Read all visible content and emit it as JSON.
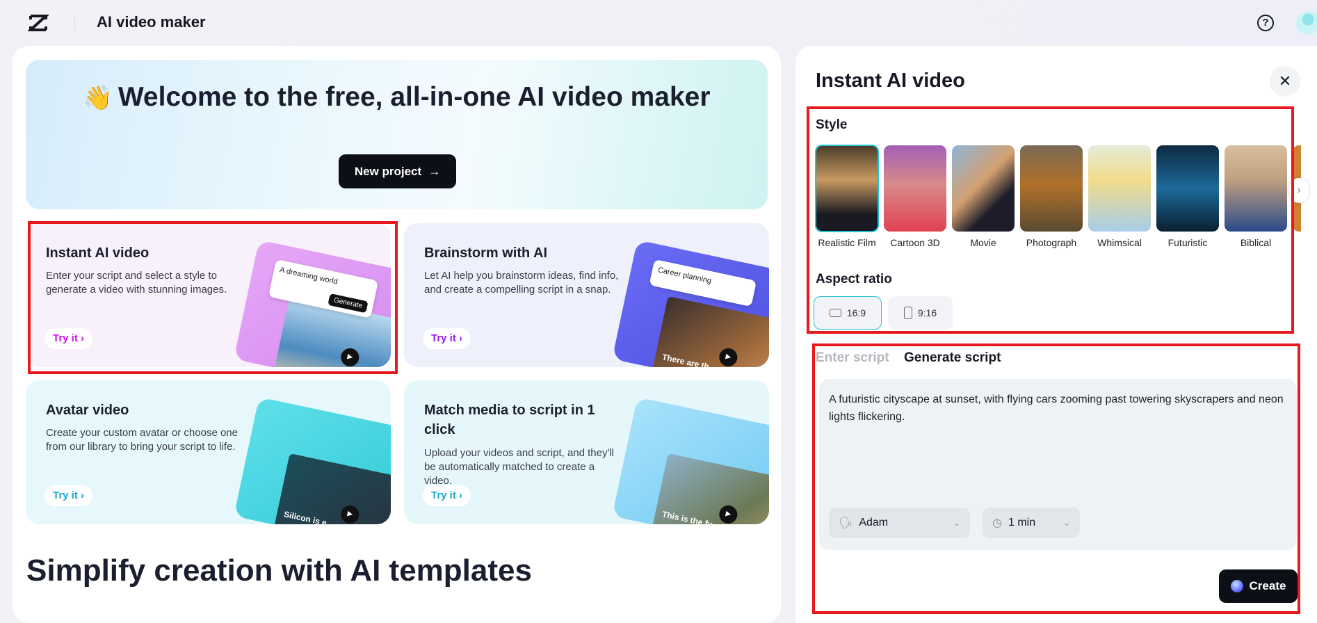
{
  "header": {
    "title": "AI video maker",
    "logo": "capcut-logo",
    "help_icon": "help-circle-icon"
  },
  "hero": {
    "emoji": "👋",
    "title": "Welcome to the free, all-in-one AI video maker",
    "button": "New project",
    "button_icon": "→"
  },
  "cards": [
    {
      "title": "Instant AI video",
      "desc": "Enter your script and select a style to generate a video with stunning images.",
      "cta": "Try it",
      "accent": "#d60ff4",
      "illus_popup": "A dreaming world",
      "illus_button": "Generate"
    },
    {
      "title": "Brainstorm with AI",
      "desc": "Let AI help you brainstorm ideas, find info, and create a compelling script in a snap.",
      "cta": "Try it",
      "accent": "#9b14f5",
      "illus_popup": "Career planning",
      "illus_caption": "There are th"
    },
    {
      "title": "Avatar video",
      "desc": "Create your custom avatar or choose one from our library to bring your script to life.",
      "cta": "Try it",
      "accent": "#16a8d8",
      "illus_caption": "Silicon is e"
    },
    {
      "title": "Match media to script in 1 click",
      "desc": "Upload your videos and script, and they'll be automatically matched to create a video.",
      "cta": "Try it",
      "accent": "#16a8d8",
      "illus_caption": "This is the fu"
    }
  ],
  "templates_heading": "Simplify creation with AI templates",
  "panel": {
    "title": "Instant AI video",
    "style_label": "Style",
    "styles": [
      {
        "label": "Realistic Film",
        "selected": true
      },
      {
        "label": "Cartoon 3D"
      },
      {
        "label": "Movie"
      },
      {
        "label": "Photograph"
      },
      {
        "label": "Whimsical"
      },
      {
        "label": "Futuristic"
      },
      {
        "label": "Biblical"
      }
    ],
    "aspect_label": "Aspect ratio",
    "aspects": [
      {
        "label": "16:9",
        "selected": true
      },
      {
        "label": "9:16"
      }
    ],
    "tabs": [
      {
        "label": "Enter script",
        "active": false
      },
      {
        "label": "Generate script",
        "active": true
      }
    ],
    "script": "A futuristic cityscape at sunset, with flying cars zooming past towering skyscrapers and neon lights flickering.",
    "voice": "Adam",
    "duration": "1 min",
    "create": "Create"
  },
  "colors": {
    "highlight": "#e8191c",
    "selected": "#24c6d6",
    "dark": "#0d0f16"
  }
}
